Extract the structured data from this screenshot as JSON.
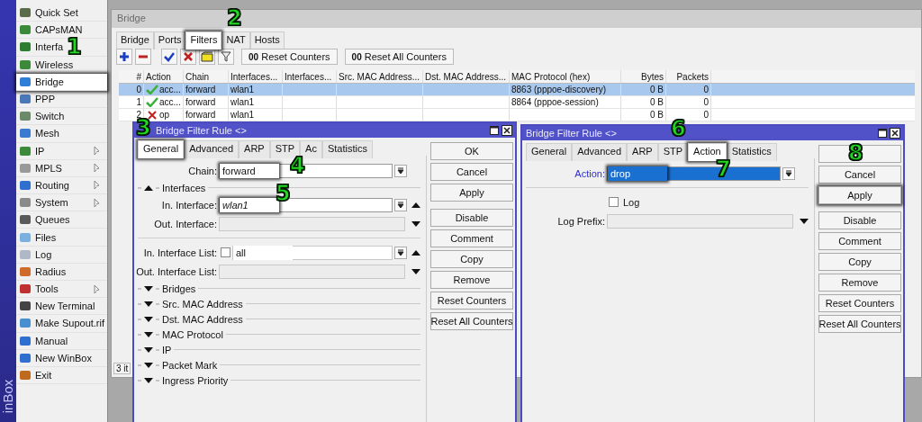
{
  "sidebar": {
    "brand": "inBox",
    "items": [
      {
        "label": "Quick Set",
        "selected": false,
        "has_submenu": false
      },
      {
        "label": "CAPsMAN",
        "selected": false,
        "has_submenu": false
      },
      {
        "label": "Interfa",
        "selected": false,
        "has_submenu": false
      },
      {
        "label": "Wireless",
        "selected": false,
        "has_submenu": false
      },
      {
        "label": "Bridge",
        "selected": true,
        "has_submenu": false
      },
      {
        "label": "PPP",
        "selected": false,
        "has_submenu": false
      },
      {
        "label": "Switch",
        "selected": false,
        "has_submenu": false
      },
      {
        "label": "Mesh",
        "selected": false,
        "has_submenu": false
      },
      {
        "label": "IP",
        "selected": false,
        "has_submenu": true
      },
      {
        "label": "MPLS",
        "selected": false,
        "has_submenu": true
      },
      {
        "label": "Routing",
        "selected": false,
        "has_submenu": true
      },
      {
        "label": "System",
        "selected": false,
        "has_submenu": true
      },
      {
        "label": "Queues",
        "selected": false,
        "has_submenu": false
      },
      {
        "label": "Files",
        "selected": false,
        "has_submenu": false
      },
      {
        "label": "Log",
        "selected": false,
        "has_submenu": false
      },
      {
        "label": "Radius",
        "selected": false,
        "has_submenu": false
      },
      {
        "label": "Tools",
        "selected": false,
        "has_submenu": true
      },
      {
        "label": "New Terminal",
        "selected": false,
        "has_submenu": false
      },
      {
        "label": "Make Supout.rif",
        "selected": false,
        "has_submenu": false
      },
      {
        "label": "Manual",
        "selected": false,
        "has_submenu": false
      },
      {
        "label": "New WinBox",
        "selected": false,
        "has_submenu": false
      },
      {
        "label": "Exit",
        "selected": false,
        "has_submenu": false
      }
    ]
  },
  "bridge_window": {
    "title": "Bridge",
    "tabs": [
      {
        "label": "Bridge",
        "selected": false
      },
      {
        "label": "Ports",
        "selected": false
      },
      {
        "label": "Filters",
        "selected": true
      },
      {
        "label": "NAT",
        "selected": false
      },
      {
        "label": "Hosts",
        "selected": false
      }
    ],
    "counter_buttons": [
      {
        "glyph": "00",
        "label": "Reset Counters"
      },
      {
        "glyph": "00",
        "label": "Reset All Counters"
      }
    ],
    "table": {
      "columns": [
        "#",
        "Action",
        "Chain",
        "Interfaces...",
        "Interfaces...",
        "Src. MAC Address...",
        "Dst. MAC Address...",
        "MAC Protocol (hex)",
        "Bytes",
        "Packets"
      ],
      "rows": [
        {
          "selected": true,
          "kind": "accept",
          "number": "0",
          "action": "acc...",
          "chain": "forward",
          "in_interfaces": "wlan1",
          "mac_protocol": "8863 (pppoe-discovery)",
          "bytes": "0 B",
          "packets": "0"
        },
        {
          "selected": false,
          "kind": "accept",
          "number": "1",
          "action": "acc...",
          "chain": "forward",
          "in_interfaces": "wlan1",
          "mac_protocol": "8864 (pppoe-session)",
          "bytes": "0 B",
          "packets": "0"
        },
        {
          "selected": false,
          "kind": "drop",
          "number": "2",
          "action": "op",
          "chain": "forward",
          "in_interfaces": "wlan1",
          "bytes": "0 B",
          "packets": "0"
        }
      ]
    },
    "status": "3 it"
  },
  "filter_dialogs": [
    {
      "title": "Bridge Filter Rule <>",
      "tabs": [
        {
          "label": "General",
          "selected": true
        },
        {
          "label": "Advanced",
          "selected": false
        },
        {
          "label": "ARP",
          "selected": false
        },
        {
          "label": "STP",
          "selected": false
        },
        {
          "label": "Ac",
          "selected": false
        },
        {
          "label": "Statistics",
          "selected": false
        }
      ],
      "fields": [
        {
          "kind": "select",
          "label": "Chain:",
          "value": "forward",
          "highlighted": true,
          "dropdown_button": true
        },
        {
          "kind": "section",
          "label": "Interfaces",
          "expanded": true
        },
        {
          "kind": "select",
          "label": "In. Interface:",
          "value": "wlan1",
          "highlighted": true,
          "dropdown_button": true,
          "removable": true
        },
        {
          "kind": "select",
          "label": "Out. Interface:",
          "disabled": true,
          "dropdown_button": false,
          "addable": true
        },
        {
          "kind": "rule"
        },
        {
          "kind": "select",
          "label": "In. Interface List:",
          "value": "all",
          "checkbox": false,
          "dropdown_button": true,
          "removable": true
        },
        {
          "kind": "select",
          "label": "Out. Interface List:",
          "disabled": true,
          "dropdown_button": false,
          "addable": true
        },
        {
          "kind": "section",
          "label": "Bridges",
          "expanded": false
        },
        {
          "kind": "section",
          "label": "Src. MAC Address",
          "expanded": false
        },
        {
          "kind": "section",
          "label": "Dst. MAC Address",
          "expanded": false
        },
        {
          "kind": "section",
          "label": "MAC Protocol",
          "expanded": false
        },
        {
          "kind": "section",
          "label": "IP",
          "expanded": false
        },
        {
          "kind": "section",
          "label": "Packet Mark",
          "expanded": false
        },
        {
          "kind": "section",
          "label": "Ingress Priority",
          "expanded": false
        }
      ],
      "buttons": [
        {
          "label": "OK",
          "highlighted": false
        },
        {
          "label": "Cancel",
          "highlighted": false
        },
        {
          "label": "Apply",
          "highlighted": false
        },
        {
          "label": "Disable",
          "highlighted": false
        },
        {
          "label": "Comment",
          "highlighted": false
        },
        {
          "label": "Copy",
          "highlighted": false
        },
        {
          "label": "Remove",
          "highlighted": false
        },
        {
          "label": "Reset Counters",
          "highlighted": false
        },
        {
          "label": "Reset All Counters",
          "highlighted": false
        }
      ]
    },
    {
      "title": "Bridge Filter Rule <>",
      "tabs": [
        {
          "label": "General",
          "selected": false
        },
        {
          "label": "Advanced",
          "selected": false
        },
        {
          "label": "ARP",
          "selected": false
        },
        {
          "label": "STP",
          "selected": false
        },
        {
          "label": "Action",
          "selected": true
        },
        {
          "label": "Statistics",
          "selected": false
        }
      ],
      "fields": [
        {
          "kind": "select",
          "label": "Action:",
          "value": "drop",
          "highlighted": true,
          "focused": true,
          "dropdown_button": true
        },
        {
          "kind": "rule"
        },
        {
          "kind": "check",
          "label": "Log",
          "checked": false
        },
        {
          "kind": "select",
          "label": "Log Prefix:",
          "disabled": true,
          "dropdown_button": false,
          "addable": true
        }
      ],
      "buttons": [
        {
          "highlighted": false
        },
        {
          "label": "Cancel",
          "highlighted": false
        },
        {
          "label": "Apply",
          "highlighted": true
        },
        {
          "label": "Disable",
          "highlighted": false
        },
        {
          "label": "Comment",
          "highlighted": false
        },
        {
          "label": "Copy",
          "highlighted": false
        },
        {
          "label": "Remove",
          "highlighted": false
        },
        {
          "label": "Reset Counters",
          "highlighted": false
        },
        {
          "label": "Reset All Counters",
          "highlighted": false
        }
      ]
    }
  ],
  "callouts": [
    {
      "number": "1"
    },
    {
      "number": "2"
    },
    {
      "number": "3"
    },
    {
      "number": "4"
    },
    {
      "number": "5"
    },
    {
      "number": "6"
    },
    {
      "number": "7"
    },
    {
      "number": "8"
    }
  ]
}
